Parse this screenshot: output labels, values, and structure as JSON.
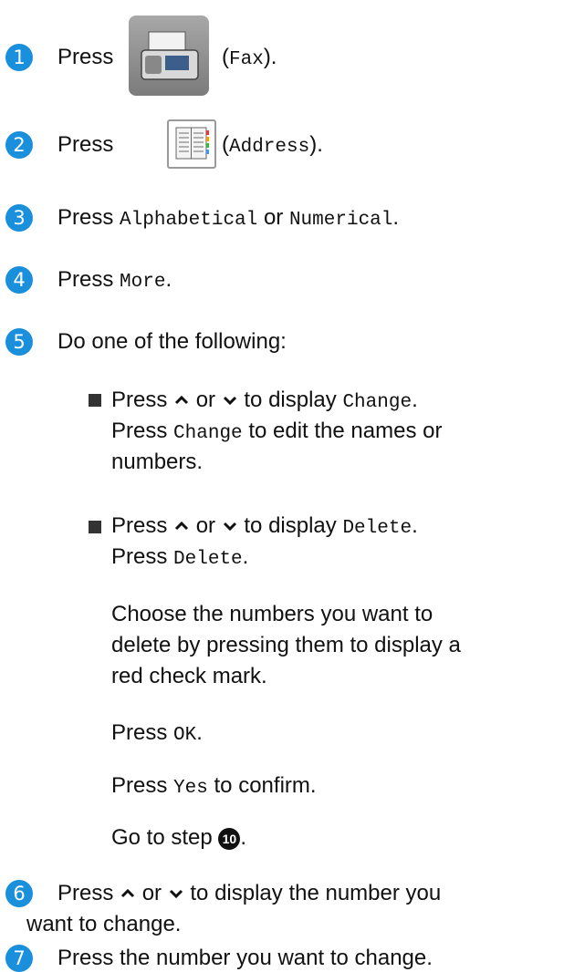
{
  "steps": [
    {
      "number": "1",
      "press": "Press",
      "button": "Fax",
      "icon": "fax-machine-icon"
    },
    {
      "number": "2",
      "press": "Press",
      "button": "Address",
      "icon": "address-book-icon"
    },
    {
      "number": "3",
      "press": "Press",
      "opt1": "Alphabetical",
      "or": "or",
      "opt2": "Numerical"
    },
    {
      "number": "4",
      "press": "Press",
      "button": "More"
    },
    {
      "number": "5",
      "text": "Do one of the following:"
    },
    {
      "number": "6",
      "line1": "to display the number you",
      "line2": "want to change."
    },
    {
      "number": "7",
      "text": "Press the number you want to change."
    }
  ],
  "bullets": {
    "change": {
      "press": "Press",
      "or": "or",
      "to_display": "to display",
      "label": "Change",
      "line2_suffix": "to edit the names or",
      "line3": "numbers."
    },
    "delete": {
      "press": "Press",
      "or": "or",
      "to_display": "to display",
      "label": "Delete",
      "para1_line1": "Choose the numbers you want to",
      "para1_line2": "delete by pressing them to display a",
      "para1_line3": "red check mark.",
      "ok": "OK",
      "yes_prefix": "Press",
      "yes": "Yes",
      "yes_suffix": "to confirm.",
      "goto": "Go to step",
      "goto_step": "10"
    }
  },
  "colors": {
    "step_circle": "#1a8fdc",
    "text": "#111111"
  }
}
